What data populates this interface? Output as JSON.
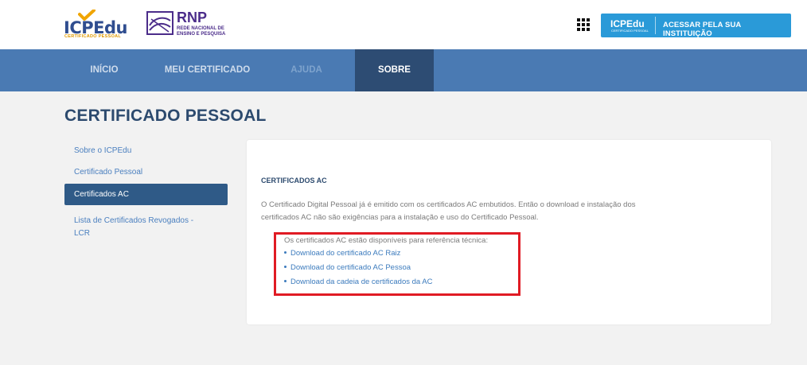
{
  "header": {
    "icp_logo": {
      "word": "ICPEdu",
      "sub": "CERTIFICADO PESSOAL"
    },
    "rnp_logo": {
      "big": "RNP",
      "small_line1": "REDE NACIONAL DE",
      "small_line2": "ENSINO E PESQUISA"
    },
    "apps_icon": "grid-apps-icon",
    "access_button": {
      "logo_word": "ICPEdu",
      "logo_sub": "CERTIFICADO PESSOAL",
      "label": "ACESSAR PELA SUA INSTITUIÇÃO"
    }
  },
  "nav": {
    "items": [
      {
        "label": "INÍCIO"
      },
      {
        "label": "MEU CERTIFICADO"
      },
      {
        "label": "AJUDA"
      },
      {
        "label": "SOBRE"
      }
    ],
    "active_index": 3
  },
  "page": {
    "title": "CERTIFICADO PESSOAL"
  },
  "sidebar": {
    "items": [
      {
        "label": "Sobre o ICPEdu"
      },
      {
        "label": "Certificado Pessoal"
      },
      {
        "label": "Certificados AC"
      },
      {
        "label": "Lista de Certificados Revogados -",
        "label2": "LCR"
      }
    ],
    "active_index": 2
  },
  "content": {
    "section_title": "CERTIFICADOS AC",
    "paragraph_line1": "O Certificado Digital Pessoal já é emitido com os certificados AC embutidos. Então o download e instalação dos",
    "paragraph_line2": "certificados AC não são exigências para a instalação e uso do Certificado Pessoal.",
    "refs_intro": "Os certificados AC estão disponíveis para referência técnica:",
    "links": [
      {
        "label": "Download do certificado AC Raiz"
      },
      {
        "label": "Download do certificado AC Pessoa"
      },
      {
        "label": "Download da cadeia de certificados da AC"
      }
    ]
  },
  "colors": {
    "nav_bg": "#4a7ab3",
    "nav_active": "#2d4c73",
    "title": "#2c4a6e",
    "link": "#3c7bbd",
    "highlight_border": "#e01b24",
    "access_button": "#2a9ad8"
  }
}
